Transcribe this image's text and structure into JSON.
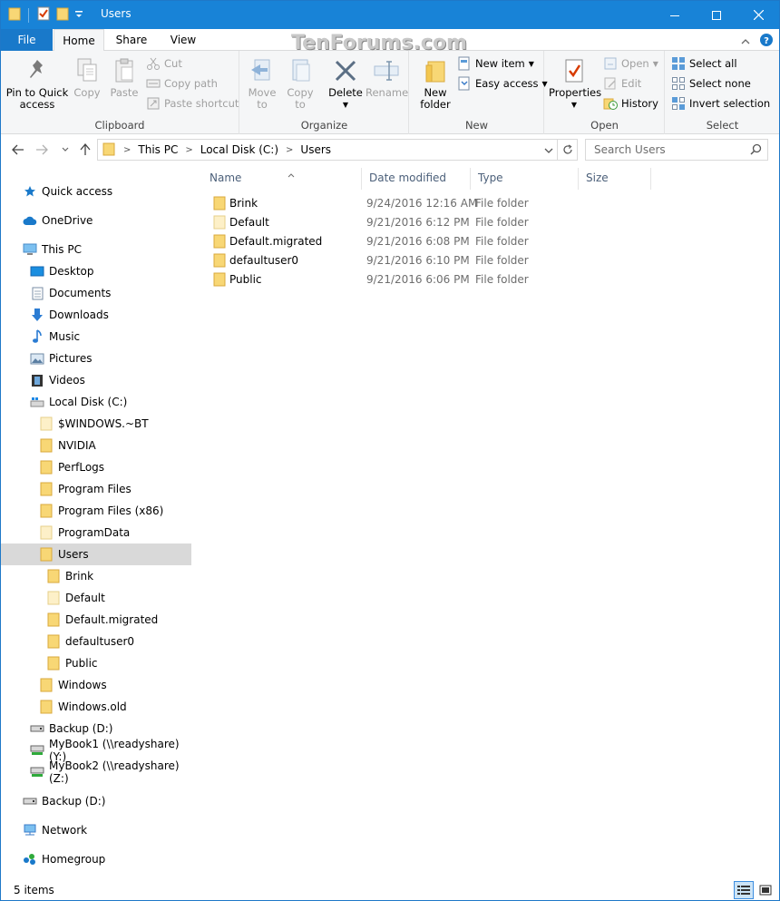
{
  "window": {
    "title": "Users"
  },
  "watermark": "TenForums.com",
  "tabs": {
    "file": "File",
    "home": "Home",
    "share": "Share",
    "view": "View"
  },
  "ribbon": {
    "clipboard": {
      "label": "Clipboard",
      "pin": "Pin to Quick",
      "pin2": "access",
      "copy": "Copy",
      "paste": "Paste",
      "cut": "Cut",
      "copy_path": "Copy path",
      "paste_shortcut": "Paste shortcut"
    },
    "organize": {
      "label": "Organize",
      "move_to": "Move",
      "move_to2": "to",
      "copy_to": "Copy",
      "copy_to2": "to",
      "delete": "Delete",
      "rename": "Rename"
    },
    "new": {
      "label": "New",
      "new_folder": "New",
      "new_folder2": "folder",
      "new_item": "New item",
      "easy_access": "Easy access"
    },
    "open": {
      "label": "Open",
      "properties": "Properties",
      "open": "Open",
      "edit": "Edit",
      "history": "History"
    },
    "select": {
      "label": "Select",
      "select_all": "Select all",
      "select_none": "Select none",
      "invert": "Invert selection"
    }
  },
  "address": {
    "crumbs": [
      "This PC",
      "Local Disk (C:)",
      "Users"
    ],
    "search_placeholder": "Search Users"
  },
  "nav": {
    "quick_access": "Quick access",
    "onedrive": "OneDrive",
    "this_pc": "This PC",
    "desktop": "Desktop",
    "documents": "Documents",
    "downloads": "Downloads",
    "music": "Music",
    "pictures": "Pictures",
    "videos": "Videos",
    "local_disk": "Local Disk (C:)",
    "c_items": [
      "$WINDOWS.~BT",
      "NVIDIA",
      "PerfLogs",
      "Program Files",
      "Program Files (x86)",
      "ProgramData",
      "Users"
    ],
    "users_items": [
      "Brink",
      "Default",
      "Default.migrated",
      "defaultuser0",
      "Public"
    ],
    "c_items2": [
      "Windows",
      "Windows.old"
    ],
    "backup_d": "Backup (D:)",
    "mybook1": "MyBook1 (\\\\readyshare) (Y:)",
    "mybook2": "MyBook2 (\\\\readyshare) (Z:)",
    "backup_d2": "Backup (D:)",
    "network": "Network",
    "homegroup": "Homegroup"
  },
  "columns": {
    "name": "Name",
    "date": "Date modified",
    "type": "Type",
    "size": "Size"
  },
  "files": [
    {
      "name": "Brink",
      "date": "9/24/2016 12:16 AM",
      "type": "File folder"
    },
    {
      "name": "Default",
      "date": "9/21/2016 6:12 PM",
      "type": "File folder"
    },
    {
      "name": "Default.migrated",
      "date": "9/21/2016 6:08 PM",
      "type": "File folder"
    },
    {
      "name": "defaultuser0",
      "date": "9/21/2016 6:10 PM",
      "type": "File folder"
    },
    {
      "name": "Public",
      "date": "9/21/2016 6:06 PM",
      "type": "File folder"
    }
  ],
  "status": {
    "items": "5 items"
  },
  "colors": {
    "accent": "#1883d7",
    "folder": "#f8d775",
    "selected": "#d9d9d9"
  },
  "icons": [
    "folder-icon",
    "pin-icon",
    "copy-icon",
    "paste-icon",
    "cut-icon",
    "delete-icon",
    "rename-icon",
    "properties-icon",
    "search-icon",
    "refresh-icon"
  ]
}
